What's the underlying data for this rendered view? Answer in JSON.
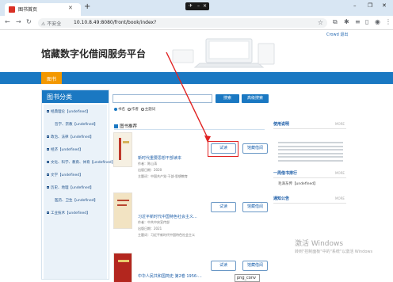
{
  "browser": {
    "tab_title": "图书首页",
    "url_warning": "不安全",
    "url": "10.10.8.49:8080/front/book/index?",
    "remote_label": "✈",
    "window_controls": [
      "–",
      "❐",
      "✕"
    ]
  },
  "header": {
    "top_links": "Crowd 退出",
    "site_title": "馆藏数字化借阅服务平台",
    "nav_active": "图书"
  },
  "categories": {
    "title": "图书分类",
    "items": [
      "经典理论【undefined】",
      "哲学、宗教【undefined】",
      "政治、法律【undefined】",
      "经济【undefined】",
      "文化、科学、教育、体育【undefined】",
      "文学【undefined】",
      "历史、地理【undefined】",
      "医药、卫生【undefined】",
      "工业技术【undefined】"
    ]
  },
  "search": {
    "placeholder": "",
    "search_button": "搜索",
    "advanced_button": "高级搜索",
    "options": [
      "书名",
      "作者",
      "主题词"
    ],
    "selected": "书名"
  },
  "recommend": {
    "heading": "图书推荐",
    "trial_label": "试读",
    "borrow_label": "馆藏借阅",
    "books": [
      {
        "title": "新时代重要思想干部读本",
        "author": "作者：陈山涛",
        "date": "出版日期：2020",
        "topic": "主题词：中国共产党-干部-思想教育"
      },
      {
        "title": "习近平新时代中国特色社会主义...",
        "author": "作者：中共中央宣传部",
        "date": "出版日期：2021",
        "topic": "主题词：习近平新时代中国特色社会主义"
      },
      {
        "title": "中华人民共和国简史 第2卷 1956-...",
        "author": "",
        "date": "",
        "topic": ""
      }
    ]
  },
  "side": {
    "usage_title": "使用说明",
    "more": "MORE",
    "rank_title": "一周借书排行",
    "rank_item": "毛泽东传【undefined】",
    "notice_title": "通知公告"
  },
  "overlay": {
    "watermark_title": "激活 Windows",
    "watermark_text": "转到\"控制面板\"中的\"系统\"以激活 Windows",
    "tooltip": "png_conv"
  },
  "colors": {
    "primary": "#1a78c2",
    "accent": "#f39800",
    "highlight": "#e02222"
  }
}
